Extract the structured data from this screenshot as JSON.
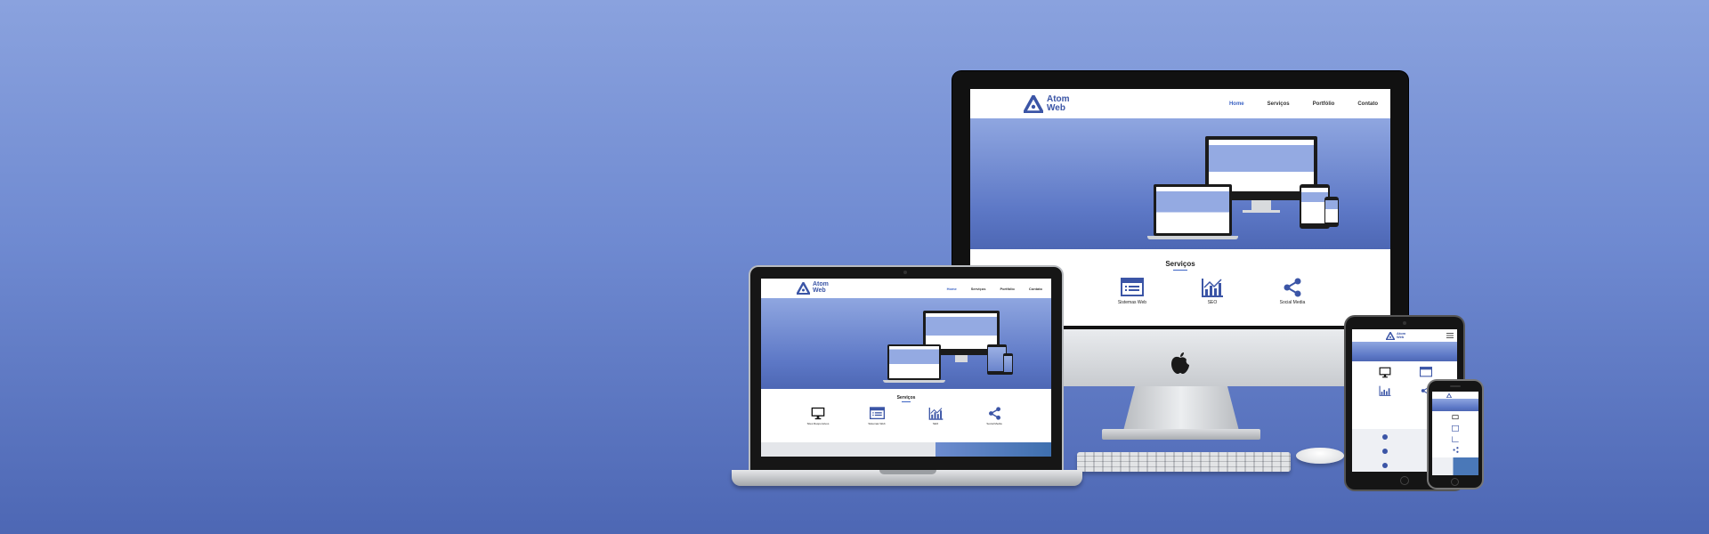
{
  "site": {
    "brand_line1": "Atom",
    "brand_line2": "Web",
    "menu": [
      "Home",
      "Serviços",
      "Portfólio",
      "Contato"
    ],
    "services_title": "Serviços",
    "services": [
      {
        "label": "Sites Responsivos",
        "icon": "monitor-icon"
      },
      {
        "label": "Sistemas Web",
        "icon": "browser-window-icon"
      },
      {
        "label": "SEO",
        "icon": "chart-icon"
      },
      {
        "label": "Social Media",
        "icon": "share-icon"
      }
    ]
  },
  "imac_services_visible": [
    "esponsivos",
    "Sistemas Web",
    "SEO",
    "Social Media"
  ],
  "colors": {
    "background_top": "#8aa2de",
    "background_bottom": "#4d67b4",
    "brand_blue": "#3b55a6",
    "accent": "#3d64c4"
  }
}
